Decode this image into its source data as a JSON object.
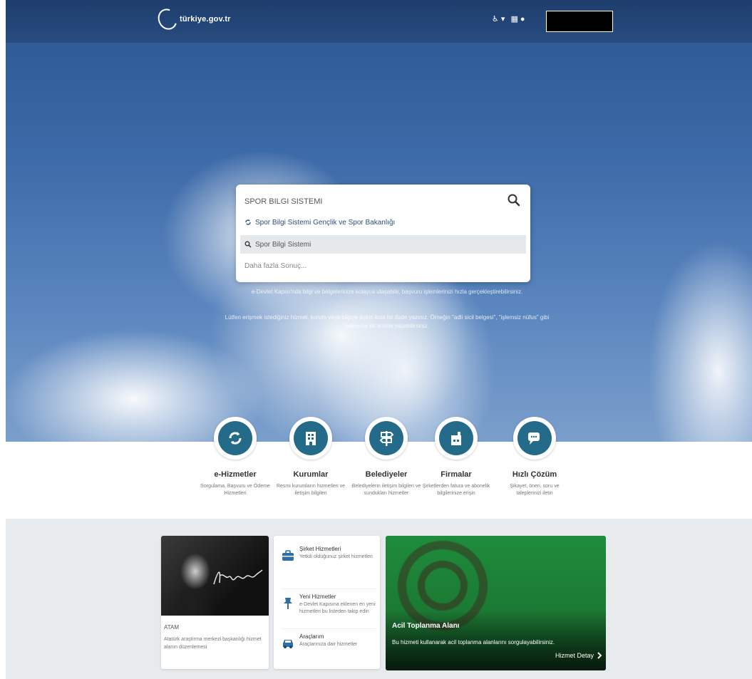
{
  "header": {
    "logo_text": "türkiye.gov.tr",
    "accessibility_label": "♿ ▾",
    "language_label": "▦ ●"
  },
  "search": {
    "value": "SPOR BILGI SISTEMI",
    "suggestions": [
      "Spor Bilgi Sistemi Gençlik ve Spor Bakanlığı",
      "Spor Bilgi Sistemi",
      "Daha fazla Sonuç..."
    ],
    "hint_1": "e-Devlet Kapısı'nda bilgi ve belgelerinize kolayca ulaşabilir, başvuru işlemlerinizi hızla gerçekleştirebilirsiniz.",
    "hint_2": "Lütfen erişmek istediğiniz hizmet, kurum veya bilgiye ilişkin kısa bir ifade yazınız. Örneğin \"adli sicil belgesi\", \"işlemsiz nüfus\" gibi kelimeler ile arama yapabilirsiniz."
  },
  "categories": [
    {
      "title": "e-Hizmetler",
      "desc": "Sorgulama, Başvuru ve Ödeme Hizmetleri"
    },
    {
      "title": "Kurumlar",
      "desc": "Resmi kurumların hizmetleri ve iletişim bilgileri"
    },
    {
      "title": "Belediyeler",
      "desc": "Belediyelerin iletişim bilgileri ve sundukları hizmetler"
    },
    {
      "title": "Firmalar",
      "desc": "Şirketlerden fatura ve abonelik bilgilerinize erişin"
    },
    {
      "title": "Hızlı Çözüm",
      "desc": "Şikayet, öneri, soru ve taleplerinizi iletin"
    }
  ],
  "ataturk_card": {
    "title": "ATAM",
    "desc": "Atatürk araştırma merkezi başkanlığı hizmet alanın düzenlemesi"
  },
  "list_card": {
    "items": [
      {
        "title": "Şirket Hizmetleri",
        "desc": "Yetkili olduğunuz şirket hizmetleri"
      },
      {
        "title": "Yeni Hizmetler",
        "desc": "e-Devlet Kapısına eklenen en yeni hizmetleri bu listeden takip edin"
      },
      {
        "title": "Araçlarım",
        "desc": "Araçlarınıza dair hizmetler"
      }
    ]
  },
  "feature_card": {
    "title": "Acil Toplanma Alanı",
    "desc": "Bu hizmeti kullanarak acil toplanma alanlarını sorgulayabilirsiniz.",
    "link": "Hizmet Detay"
  },
  "colors": {
    "topbar": "#1d3d6c",
    "icon_teal": "#246b8a",
    "feature_green": "#1b7a33"
  }
}
